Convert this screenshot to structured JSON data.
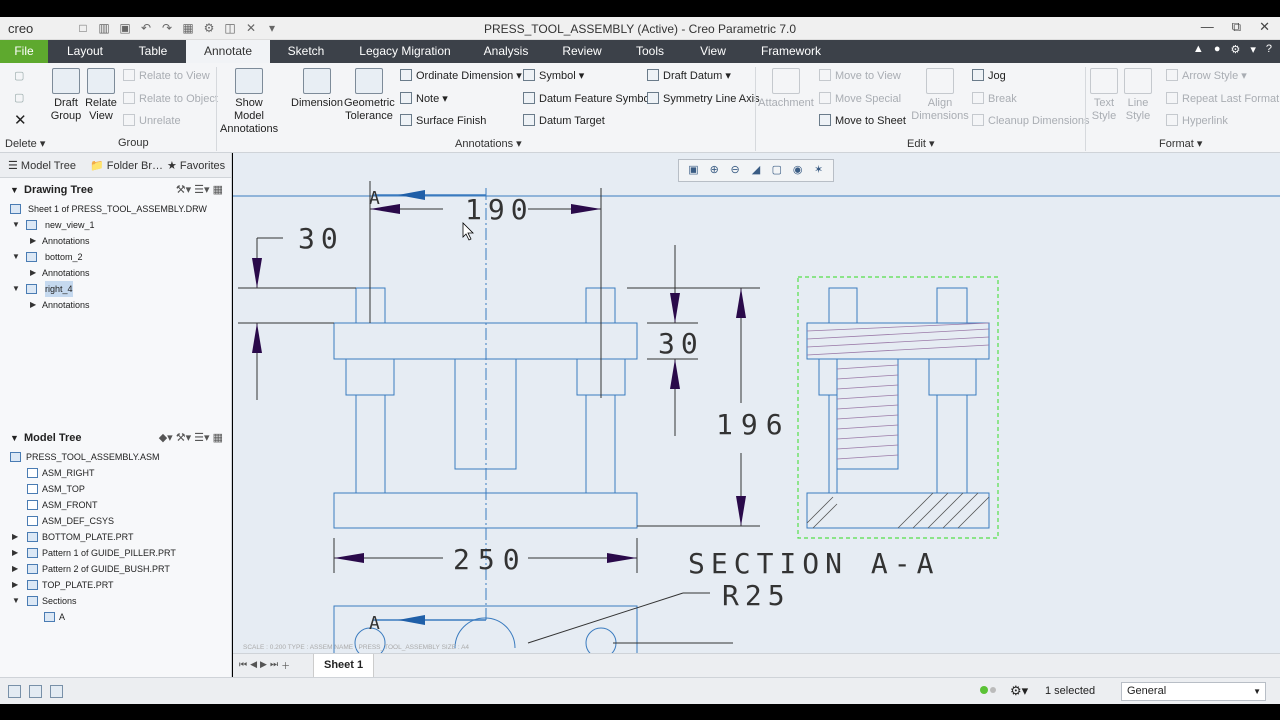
{
  "app": {
    "logo": "creo",
    "title": "PRESS_TOOL_ASSEMBLY (Active) - Creo Parametric 7.0"
  },
  "menu": {
    "tabs": [
      "File",
      "Layout",
      "Table",
      "Annotate",
      "Sketch",
      "Legacy Migration",
      "Analysis",
      "Review",
      "Tools",
      "View",
      "Framework"
    ],
    "active": "Annotate"
  },
  "ribbon": {
    "delete_group": "Delete",
    "draft_group": "Draft\nGroup",
    "relate_view": "Relate\nView",
    "relate_to_view": "Relate to View",
    "relate_to_object": "Relate to Object",
    "unrelate": "Unrelate",
    "group_label": "Group",
    "show_model_annotations": "Show Model\nAnnotations",
    "dimension": "Dimension",
    "geometric_tolerance": "Geometric\nTolerance",
    "ordinate_dimension": "Ordinate Dimension",
    "note": "Note",
    "surface_finish": "Surface Finish",
    "symbol": "Symbol",
    "datum_feature_symbol": "Datum Feature Symbol",
    "datum_target": "Datum Target",
    "draft_datum": "Draft Datum",
    "symmetry_line_axis": "Symmetry Line Axis",
    "annotations_label": "Annotations",
    "attachment": "Attachment",
    "move_to_view": "Move to View",
    "move_special": "Move Special",
    "move_to_sheet": "Move to Sheet",
    "align_dimensions": "Align\nDimensions",
    "jog": "Jog",
    "break": "Break",
    "cleanup_dimensions": "Cleanup Dimensions",
    "edit_label": "Edit",
    "text_style": "Text\nStyle",
    "line_style": "Line\nStyle",
    "arrow_style": "Arrow Style",
    "repeat_last_format": "Repeat Last Format",
    "hyperlink": "Hyperlink",
    "format_label": "Format"
  },
  "panel_tabs": [
    "Model Tree",
    "Folder Br…",
    "Favorites"
  ],
  "drawing_tree": {
    "header": "Drawing Tree",
    "items": [
      {
        "label": "Sheet 1 of PRESS_TOOL_ASSEMBLY.DRW",
        "level": 0
      },
      {
        "label": "new_view_1",
        "level": 1
      },
      {
        "label": "Annotations",
        "level": 2
      },
      {
        "label": "bottom_2",
        "level": 1
      },
      {
        "label": "Annotations",
        "level": 2
      },
      {
        "label": "right_4",
        "level": 1,
        "selected": true
      },
      {
        "label": "Annotations",
        "level": 2
      }
    ]
  },
  "model_tree": {
    "header": "Model Tree",
    "items": [
      {
        "label": "PRESS_TOOL_ASSEMBLY.ASM"
      },
      {
        "label": "ASM_RIGHT"
      },
      {
        "label": "ASM_TOP"
      },
      {
        "label": "ASM_FRONT"
      },
      {
        "label": "ASM_DEF_CSYS"
      },
      {
        "label": "BOTTOM_PLATE.PRT"
      },
      {
        "label": "Pattern 1 of GUIDE_PILLER.PRT"
      },
      {
        "label": "Pattern 2 of GUIDE_BUSH.PRT"
      },
      {
        "label": "TOP_PLATE.PRT"
      },
      {
        "label": "Sections"
      },
      {
        "label": "A"
      }
    ]
  },
  "drawing": {
    "dim_190": "190",
    "dim_30_top": "30",
    "dim_30_right": "30",
    "dim_196": "196",
    "dim_250": "250",
    "section_label": "SECTION A-A",
    "r25": "R25",
    "section_marker": "A",
    "section_marker2": "A",
    "footer": "SCALE : 0.200    TYPE : ASSEM    NAME : PRESS_TOOL_ASSEMBLY    SIZE : A4"
  },
  "sheet_tab": "Sheet 1",
  "status": {
    "selected": "1 selected",
    "filter": "General"
  }
}
